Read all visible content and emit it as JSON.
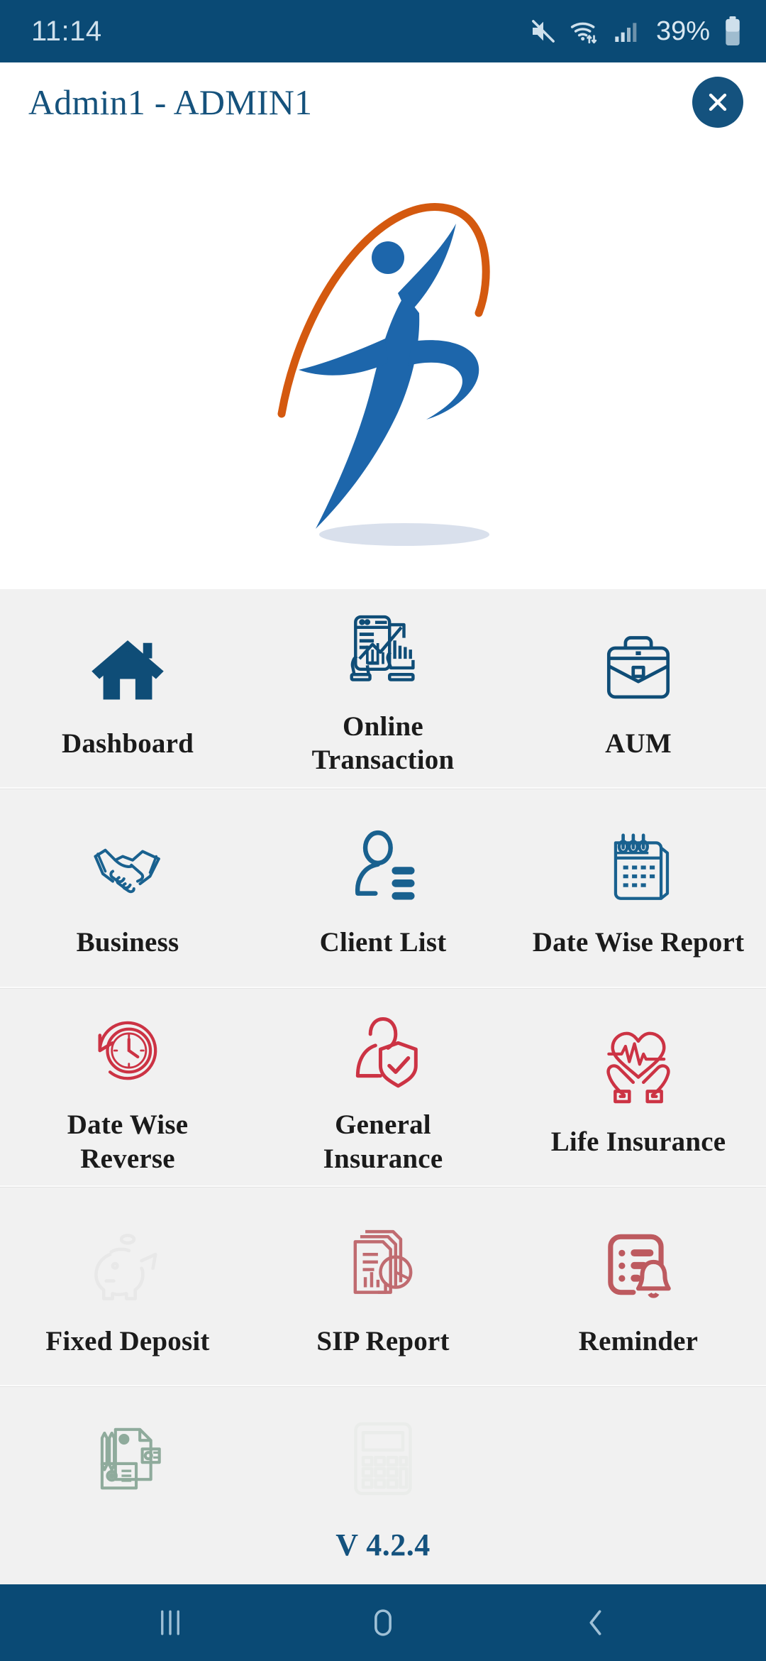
{
  "status_bar": {
    "time": "11:14",
    "battery_percent": "39%",
    "icons": [
      "mute-icon",
      "wifi-icon",
      "signal-icon",
      "battery-icon"
    ],
    "background_color": "#0a4a75",
    "text_color": "#cfe0ec"
  },
  "header": {
    "title": "Admin1 - ADMIN1",
    "close_label": "×",
    "title_color": "#15527c",
    "close_bg_color": "#14527e"
  },
  "logo": {
    "name": "company-logo",
    "arc_color": "#d4590f",
    "figure_color": "#1d66ab"
  },
  "menu": {
    "background_color": "#f1f1f1",
    "rows": [
      {
        "items": [
          {
            "label": "Dashboard",
            "icon": "home-icon",
            "color": "#0f4d77",
            "enabled": true
          },
          {
            "label": "Online\nTransaction",
            "icon": "online-transaction-icon",
            "color": "#0f4d77",
            "enabled": true
          },
          {
            "label": "AUM",
            "icon": "briefcase-icon",
            "color": "#0f4d77",
            "enabled": true
          }
        ]
      },
      {
        "items": [
          {
            "label": "Business",
            "icon": "handshake-icon",
            "color": "#19618f",
            "enabled": true
          },
          {
            "label": "Client List",
            "icon": "client-list-icon",
            "color": "#19618f",
            "enabled": true
          },
          {
            "label": "Date Wise Report",
            "icon": "calendar-icon",
            "color": "#19618f",
            "enabled": true
          }
        ]
      },
      {
        "items": [
          {
            "label": "Date Wise\nReverse",
            "icon": "clock-reverse-icon",
            "color": "#cc3344",
            "enabled": true
          },
          {
            "label": "General\nInsurance",
            "icon": "person-shield-icon",
            "color": "#cc3344",
            "enabled": true
          },
          {
            "label": "Life Insurance",
            "icon": "heart-hands-icon",
            "color": "#cc3344",
            "enabled": true
          }
        ]
      },
      {
        "items": [
          {
            "label": "Fixed Deposit",
            "icon": "piggy-bank-icon",
            "color": "#ececec",
            "enabled": false
          },
          {
            "label": "SIP Report",
            "icon": "sip-report-icon",
            "color": "#c06b70",
            "enabled": true
          },
          {
            "label": "Reminder",
            "icon": "reminder-bell-icon",
            "color": "#bd5a5f",
            "enabled": true
          }
        ]
      },
      {
        "items": [
          {
            "label": "",
            "icon": "documents-pencil-icon",
            "color": "#8fab9c",
            "enabled": false
          },
          {
            "label": "",
            "icon": "calculator-icon",
            "color": "#eaecea",
            "enabled": false
          },
          {
            "label": "",
            "icon": "",
            "color": "",
            "enabled": false
          }
        ]
      }
    ]
  },
  "version": {
    "text": "V 4.2.4",
    "color": "#14527e"
  },
  "nav_bar": {
    "buttons": [
      {
        "name": "recents-icon",
        "label": "recents"
      },
      {
        "name": "home-icon",
        "label": "home"
      },
      {
        "name": "back-icon",
        "label": "back"
      }
    ],
    "background_color": "#0a4a75",
    "icon_color": "#9fc0d6"
  }
}
